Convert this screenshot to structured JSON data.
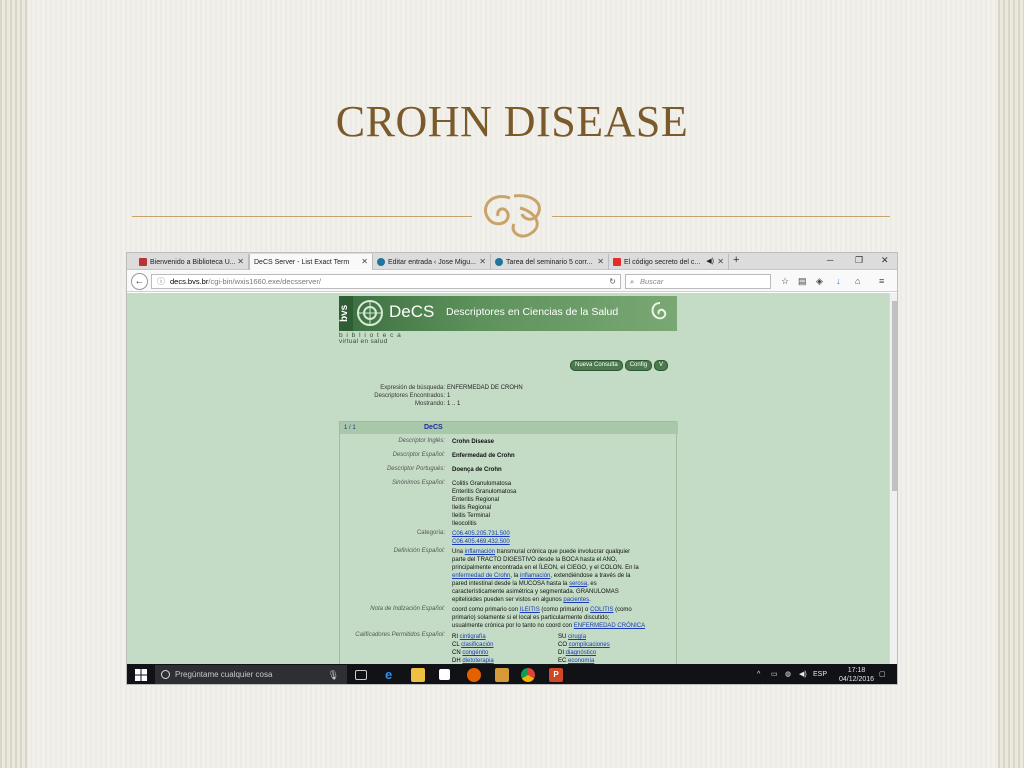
{
  "slide": {
    "title": "CROHN DISEASE",
    "colors": {
      "title": "#7a5a2a",
      "divider": "#c9a46a"
    }
  },
  "browser": {
    "tabs": [
      {
        "label": "Bienvenido a Biblioteca U...",
        "favicon": "library-icon",
        "active": false
      },
      {
        "label": "DeCS Server - List Exact Term",
        "favicon": "none",
        "active": true
      },
      {
        "label": "Editar entrada ‹ Jose Migu...",
        "favicon": "wordpress-icon",
        "active": false
      },
      {
        "label": "Tarea del seminario 5 corr...",
        "favicon": "wordpress-icon",
        "active": false
      },
      {
        "label": "El código secreto del c...",
        "favicon": "youtube-icon",
        "active": false
      }
    ],
    "url_host": "decs.bvs.br",
    "url_path": "/cgi-bin/wxis1660.exe/decsserver/",
    "search_placeholder": "Buscar"
  },
  "page": {
    "banner_bvs": "bvs",
    "banner_decs": "DeCS",
    "banner_subtitle": "Descriptores en Ciencias de la Salud",
    "logo_line1": "b i b l i o t e c a",
    "logo_line2": "virtual en salud",
    "buttons": {
      "new_query": "Nueva Consulta",
      "config": "Config",
      "v": "V"
    },
    "meta": {
      "expr_label": "Expresión de búsqueda:",
      "expr_value": "ENFERMEDAD DE CROHN",
      "found_label": "Descriptores Encontrados:",
      "found_value": "1",
      "showing_label": "Mostrando:",
      "showing_value": "1 .. 1"
    },
    "result": {
      "number": "1 / 1",
      "header": "DeCS",
      "english_label": "Descriptor Inglés:",
      "english": "Crohn Disease",
      "spanish_label": "Descriptor Español:",
      "spanish": "Enfermedad de Crohn",
      "portuguese_label": "Descriptor Portugués:",
      "portuguese": "Doença de Crohn",
      "synonyms_label": "Sinónimos Español:",
      "synonyms": [
        "Colitis Granulomatosa",
        "Enteritis Granulomatosa",
        "Enteritis Regional",
        "Ileitis Regional",
        "Ileitis Terminal",
        "Ileocolitis"
      ],
      "category_label": "Categoría:",
      "categories": [
        "C06.405.205.731.500",
        "C06.405.469.432.500"
      ],
      "definition_label": "Definición Español:",
      "definition": [
        {
          "pre": "Una ",
          "link": "inflamación",
          "post": " transmural crónica que puede involucrar qualquier"
        },
        {
          "pre": "parte del TRACTO DIGESTIVO desde la BOCA hasta el ANO,",
          "link": "",
          "post": ""
        },
        {
          "pre": "principalmente encontrada en el ÍLEON, el CIEGO, y el COLON. En la",
          "link": "",
          "post": ""
        },
        {
          "pre": "",
          "link": "enfermedad de Crohn",
          "post": ", la ",
          "link2": "inflamación",
          "post2": ", extendiéndose a través de la"
        },
        {
          "pre": "pared intestinal desde la MUCOSA hasta la ",
          "link": "serosa",
          "post": ", es"
        },
        {
          "pre": "característicamente asimétrica y segmentada. GRANULOMAS",
          "link": "",
          "post": ""
        },
        {
          "pre": "epitelioides pueden ser vistos en algunos ",
          "link": "pacientes",
          "post": "."
        }
      ],
      "indexing_label": "Nota de Indización Español:",
      "indexing": [
        {
          "pre": "coord como primario con ",
          "link": "ILEITIS",
          "post": " (como primario) o ",
          "link2": "COLITIS",
          "post2": " (como"
        },
        {
          "pre": "primario) solamente si el local es particularmente discutido;",
          "link": "",
          "post": ""
        },
        {
          "pre": "usualmente crónica por lo tanto no coord con ",
          "link": "ENFERMEDAD CRÓNICA",
          "post": ""
        }
      ],
      "qualifiers_label": "Calificadores Permitidos Español:",
      "qualifiers_left": [
        {
          "code": "RI",
          "name": "cintigrafía"
        },
        {
          "code": "CL",
          "name": "clasificación"
        },
        {
          "code": "CN",
          "name": "congénito"
        },
        {
          "code": "DH",
          "name": "dietoterapia"
        }
      ],
      "qualifiers_right": [
        {
          "code": "SU",
          "name": "cirugía"
        },
        {
          "code": "CO",
          "name": "complicaciones"
        },
        {
          "code": "DI",
          "name": "diagnóstico"
        },
        {
          "code": "EC",
          "name": "economía"
        }
      ]
    }
  },
  "taskbar": {
    "search_text": "Pregúntame cualquier cosa",
    "lang": "ESP",
    "time": "17:18",
    "date": "04/12/2016"
  }
}
